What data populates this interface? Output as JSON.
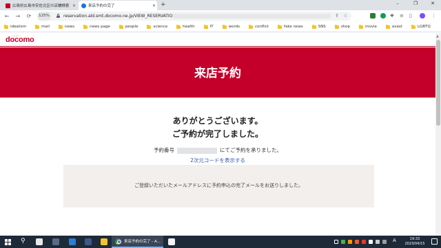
{
  "browser": {
    "tabs": [
      {
        "label": "広島県広島市安佐北区の店舗検索",
        "active": false
      },
      {
        "label": "来店予約の完了",
        "active": true
      }
    ],
    "new_tab": "+",
    "window_controls": {
      "minimize": "–",
      "restore": "❐",
      "close": "✕"
    },
    "nav": {
      "back": "←",
      "forward": "→",
      "reload": "⟳"
    },
    "zoom": "125%",
    "url": "reservation.ald.smt.docomo.ne.jp/VIEW_RESERVATION/",
    "omnibox_icons": [
      "share-icon",
      "bookmark-star-icon"
    ],
    "extensions": [
      "shield-extension-icon",
      "green-extension-icon",
      "puzzle-extensions-icon",
      "reading-list-icon",
      "sidebar-icon",
      "profile-icon",
      "menu-icon"
    ]
  },
  "bookmarks": [
    "idealism",
    "mail",
    "news",
    "news page",
    "people",
    "science",
    "health",
    "IT",
    "words",
    "conflict",
    "fake news",
    "SNS",
    "shop",
    "movie",
    "avast",
    "LGBTQ"
  ],
  "site": {
    "logo": "docomo",
    "page_title": "来店予約",
    "thanks_line1": "ありがとうございます。",
    "thanks_line2": "ご予約が完了しました。",
    "reservation_label": "予約番号",
    "reservation_suffix": "にてご予約を承りました。",
    "qr_link": "2次元コードを表示する",
    "mail_notice": "ご登録いただいたメールアドレスに予約申込の完了メールをお送りしました。"
  },
  "taskbar": {
    "active_app_label": "来店予約の完了 - A...",
    "ime_indicator": "A",
    "time": "19:33",
    "date": "2023/04/15"
  },
  "colors": {
    "brand_red": "#c4002a",
    "link_blue": "#2b5aa6",
    "notice_bg": "#f2efed",
    "taskbar_bg": "#1f2a38"
  }
}
